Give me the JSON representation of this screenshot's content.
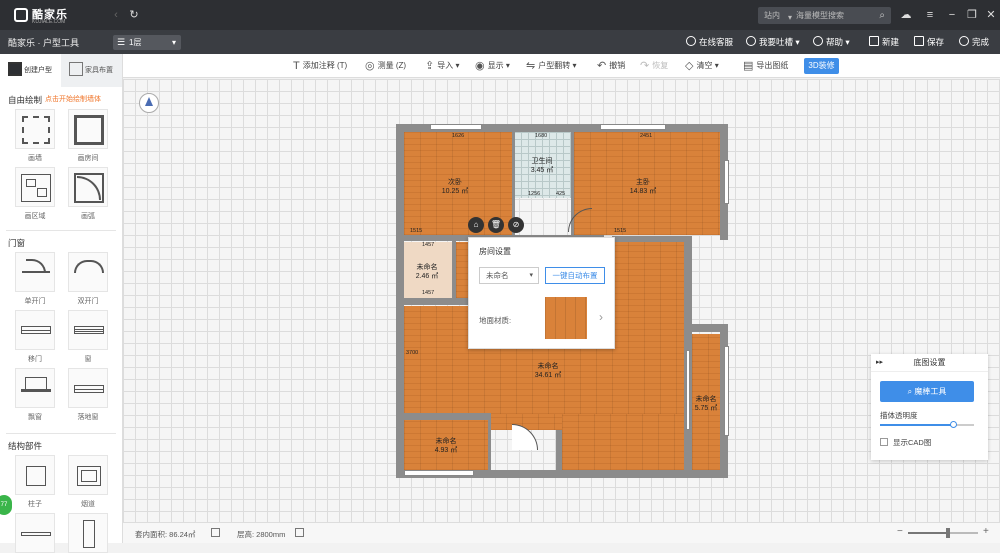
{
  "titlebar": {
    "logo": "酷家乐",
    "logo_sub": "KUJIALE.COM",
    "search_scope": "站内",
    "search_placeholder": "海量模型搜索",
    "back_icon": "back-icon",
    "refresh_icon": "refresh-icon"
  },
  "menubar": {
    "app_title": "酷家乐 · 户型工具",
    "floor": "1层",
    "items": [
      {
        "label": "在线客服",
        "icon": "service-icon"
      },
      {
        "label": "我要吐槽",
        "icon": "feedback-icon"
      },
      {
        "label": "帮助",
        "icon": "help-icon"
      },
      {
        "label": "新建",
        "icon": "new-icon"
      },
      {
        "label": "保存",
        "icon": "save-icon"
      },
      {
        "label": "完成",
        "icon": "power-icon"
      }
    ]
  },
  "toolbar": {
    "items": [
      {
        "label": "添加注释 (T)",
        "glyph": "T"
      },
      {
        "label": "测量 (Z)",
        "glyph": "◎"
      },
      {
        "label": "导入",
        "glyph": "⇪"
      },
      {
        "label": "显示",
        "glyph": "◉"
      },
      {
        "label": "户型翻转",
        "glyph": "⇋"
      },
      {
        "label": "撤销",
        "glyph": "↶"
      },
      {
        "label": "恢复",
        "glyph": "↷"
      },
      {
        "label": "清空",
        "glyph": "◇"
      },
      {
        "label": "导出图纸",
        "glyph": "▤"
      }
    ],
    "btn_3d": "3D装修"
  },
  "leftpanel": {
    "tabs": [
      "创建户型",
      "家具布置"
    ],
    "sections": {
      "free_draw": "自由绘制",
      "hint": "点击开始绘制墙体",
      "doors": "门窗",
      "structure": "结构部件"
    },
    "free_draw_items": [
      "画墙",
      "画房间",
      "画区域",
      "画弧"
    ],
    "door_items": [
      "单开门",
      "双开门",
      "移门",
      "窗",
      "飘窗",
      "落地窗"
    ],
    "structure_items": [
      "柱子",
      "烟道"
    ]
  },
  "floorplan": {
    "rooms": [
      {
        "name": "次卧",
        "area": "10.25 ㎡"
      },
      {
        "name": "卫生间",
        "area": "3.45 ㎡"
      },
      {
        "name": "主卧",
        "area": "14.83 ㎡"
      },
      {
        "name": "未命名",
        "area": "2.46 ㎡"
      },
      {
        "name": "未命名",
        "area": "34.61 ㎡"
      },
      {
        "name": "未命名",
        "area": "4.93 ㎡"
      },
      {
        "name": "未命名",
        "area": "5.75 ㎡"
      }
    ],
    "dims": [
      "1626",
      "1680",
      "2451",
      "1256",
      "425",
      "1457",
      "1457",
      "1515",
      "1515",
      "3700"
    ]
  },
  "room_popup": {
    "title": "房间设置",
    "name_value": "未命名",
    "auto_layout": "一键自动布置",
    "material_label": "地面材质:"
  },
  "base_panel": {
    "title": "底图设置",
    "magic_tool": "魔棒工具",
    "transparency_label": "描体透明度",
    "transparency": 0.78,
    "show_cad": "显示CAD图"
  },
  "statusbar": {
    "area_label": "套内面积: 86.24㎡",
    "height_label": "层高: 2800mm"
  },
  "zoom": 0.57
}
